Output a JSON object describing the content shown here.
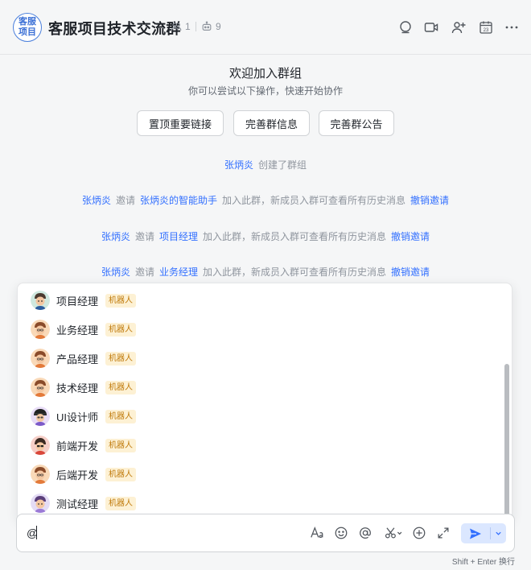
{
  "header": {
    "avatar_text": "客服项目",
    "title": "客服项目技术交流群",
    "member_count": "1",
    "bot_count": "9",
    "icons": [
      "search-chat-icon",
      "video-icon",
      "add-member-icon",
      "calendar-icon",
      "more-icon"
    ],
    "calendar_day": "23"
  },
  "welcome": {
    "title": "欢迎加入群组",
    "subtitle": "你可以尝试以下操作，快速开始协作",
    "buttons": [
      "置顶重要链接",
      "完善群信息",
      "完善群公告"
    ]
  },
  "system_messages": [
    {
      "actor": "张炳炎",
      "text": "创建了群组"
    },
    {
      "actor": "张炳炎",
      "verb": "邀请",
      "target": "张炳炎的智能助手",
      "text": "加入此群，新成员入群可查看所有历史消息",
      "action": "撤销邀请"
    },
    {
      "actor": "张炳炎",
      "verb": "邀请",
      "target": "项目经理",
      "text": "加入此群，新成员入群可查看所有历史消息",
      "action": "撤销邀请"
    },
    {
      "actor": "张炳炎",
      "verb": "邀请",
      "target": "业务经理",
      "text": "加入此群，新成员入群可查看所有历史消息",
      "action": "撤销邀请"
    }
  ],
  "mention_list": {
    "badge": "机器人",
    "items": [
      {
        "name": "项目经理",
        "avatar": "robot-avatar-green"
      },
      {
        "name": "业务经理",
        "avatar": "robot-avatar-orange"
      },
      {
        "name": "产品经理",
        "avatar": "robot-avatar-orange"
      },
      {
        "name": "技术经理",
        "avatar": "robot-avatar-orange"
      },
      {
        "name": "UI设计师",
        "avatar": "robot-avatar-purple"
      },
      {
        "name": "前端开发",
        "avatar": "robot-avatar-red"
      },
      {
        "name": "后端开发",
        "avatar": "robot-avatar-orange"
      },
      {
        "name": "测试经理",
        "avatar": "robot-avatar-lilac"
      }
    ]
  },
  "composer": {
    "value": "@",
    "toolbar_icons": [
      "text-format-icon",
      "emoji-icon",
      "mention-icon",
      "screenshot-icon",
      "add-icon",
      "expand-icon"
    ],
    "send_hint": "Shift + Enter 换行"
  },
  "colors": {
    "accent": "#3370ff",
    "badge_bg": "#fdf1d4",
    "badge_text": "#c07a0a"
  }
}
